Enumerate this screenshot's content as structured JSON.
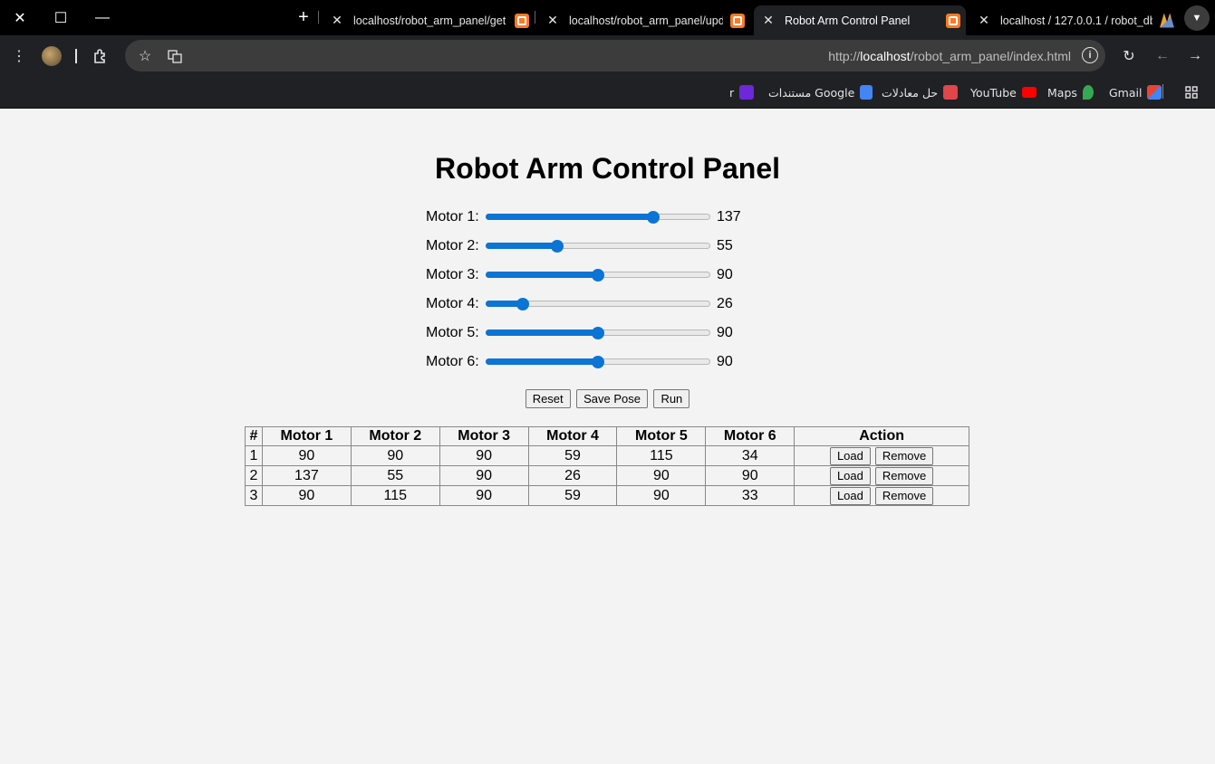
{
  "browser": {
    "tabs": [
      {
        "title": "localhost/robot_arm_panel/get",
        "active": false
      },
      {
        "title": "localhost/robot_arm_panel/upd",
        "active": false
      },
      {
        "title": "Robot Arm Control Panel",
        "active": true
      },
      {
        "title": "localhost / 127.0.0.1 / robot_db",
        "active": false
      }
    ],
    "url_scheme": "http://",
    "url_host": "localhost",
    "url_path": "/robot_arm_panel/index.html",
    "bookmarks": [
      "Gmail",
      "Maps",
      "YouTube",
      "حل معادلات",
      "مستندات Google",
      "r"
    ]
  },
  "page": {
    "title": "Robot Arm Control Panel",
    "motors": [
      {
        "label": "Motor 1:",
        "value": "137",
        "num": 137
      },
      {
        "label": "Motor 2:",
        "value": "55",
        "num": 55
      },
      {
        "label": "Motor 3:",
        "value": "90",
        "num": 90
      },
      {
        "label": "Motor 4:",
        "value": "26",
        "num": 26
      },
      {
        "label": "Motor 5:",
        "value": "90",
        "num": 90
      },
      {
        "label": "Motor 6:",
        "value": "90",
        "num": 90
      }
    ],
    "slider_max": 180,
    "buttons": {
      "reset": "Reset",
      "save": "Save Pose",
      "run": "Run"
    },
    "table": {
      "headers": [
        "#",
        "Motor 1",
        "Motor 2",
        "Motor 3",
        "Motor 4",
        "Motor 5",
        "Motor 6",
        "Action"
      ],
      "rows": [
        {
          "id": "1",
          "values": [
            "90",
            "90",
            "90",
            "59",
            "115",
            "34"
          ]
        },
        {
          "id": "2",
          "values": [
            "137",
            "55",
            "90",
            "26",
            "90",
            "90"
          ]
        },
        {
          "id": "3",
          "values": [
            "90",
            "115",
            "90",
            "59",
            "90",
            "33"
          ]
        }
      ],
      "load_label": "Load",
      "remove_label": "Remove"
    }
  },
  "colors": {
    "accent": "#0b74d4",
    "background": "#f3f3f3"
  }
}
